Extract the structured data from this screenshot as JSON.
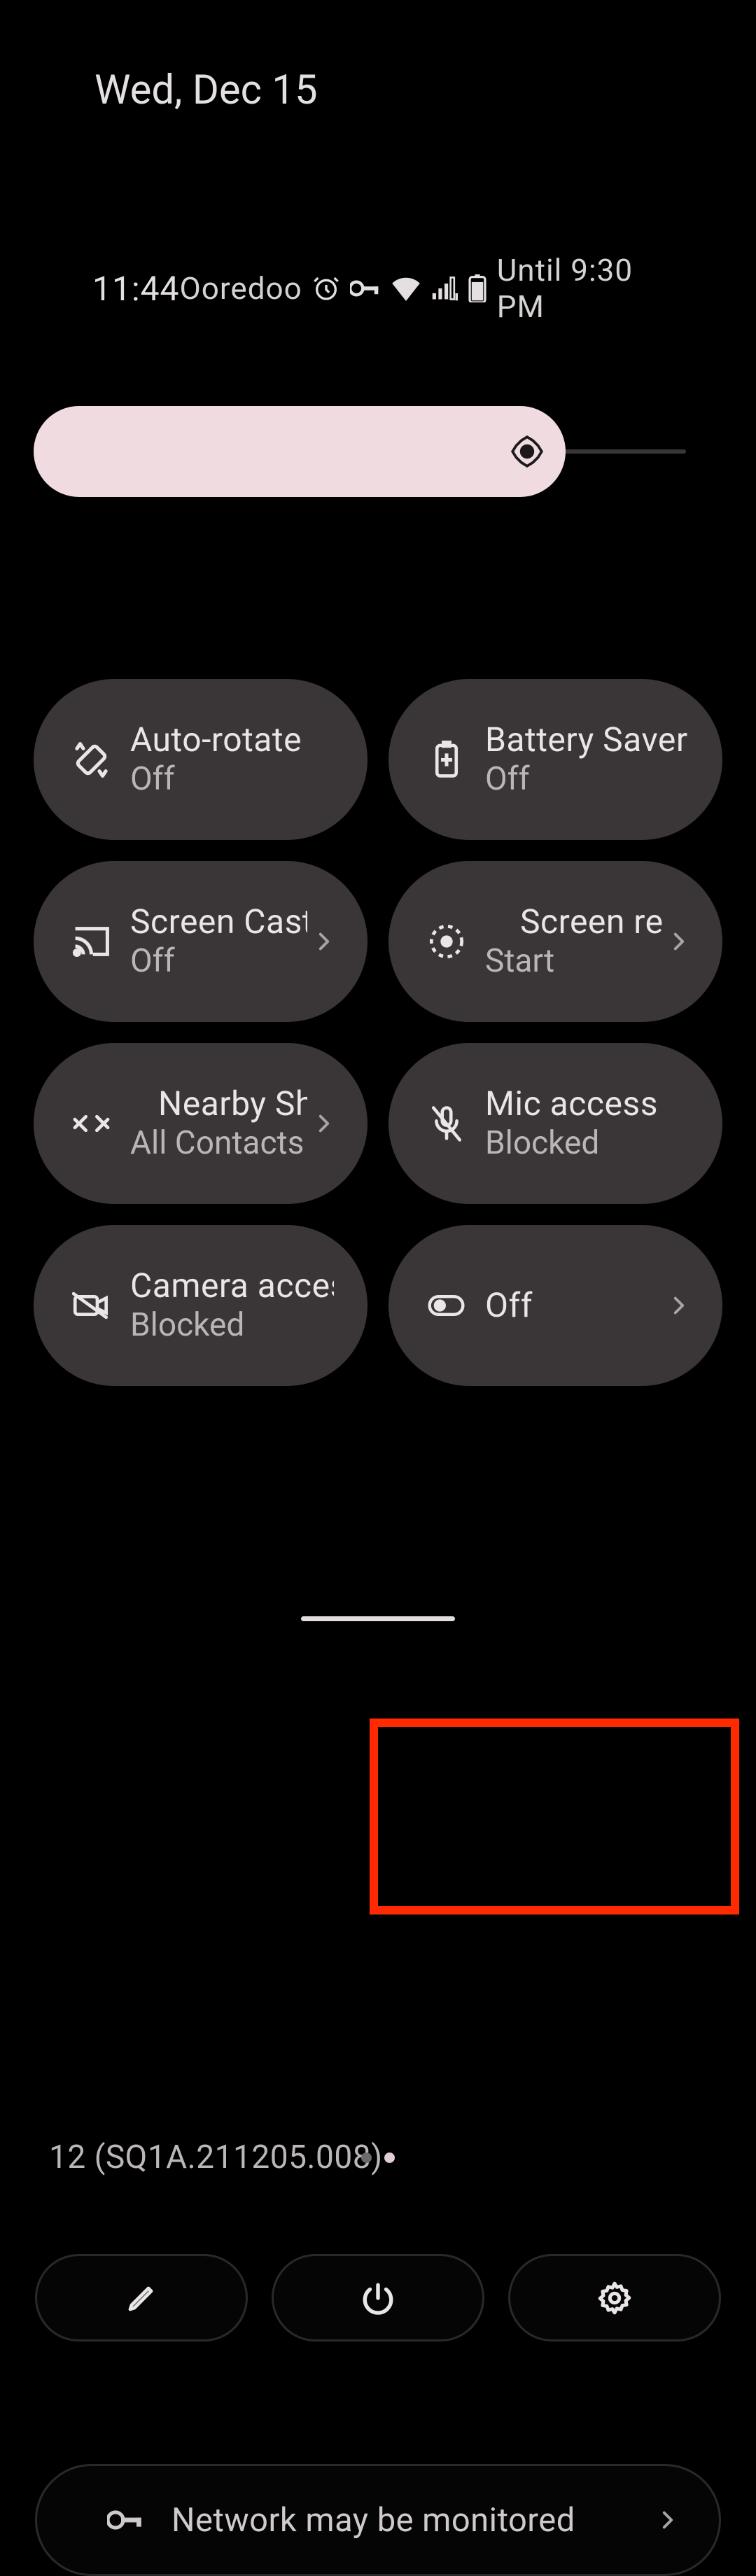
{
  "date": "Wed, Dec 15",
  "status": {
    "time": "11:44",
    "carrier": "Ooredoo",
    "until": "Until 9:30 PM"
  },
  "brightness": {
    "percent": 79
  },
  "tiles": [
    {
      "title": "Auto-rotate",
      "sub": "Off",
      "chevron": false
    },
    {
      "title": "Battery Saver",
      "sub": "Off",
      "chevron": false
    },
    {
      "title": "Screen Cast",
      "sub": "Off",
      "chevron": true
    },
    {
      "title": "Screen rec",
      "sub": "Start",
      "chevron": true
    },
    {
      "title": "Nearby Sh",
      "sub": "All Contacts",
      "chevron": true
    },
    {
      "title": "Mic access",
      "sub": "Blocked",
      "chevron": false
    },
    {
      "title": "Camera access",
      "sub": "Blocked",
      "chevron": false
    },
    {
      "title": "Off",
      "sub": "",
      "chevron": true
    }
  ],
  "highlighted_tile_index": 7,
  "build": "12 (SQ1A.211205.008)",
  "notice": "Network may be monitored",
  "pager": {
    "count": 2,
    "active": 1
  }
}
